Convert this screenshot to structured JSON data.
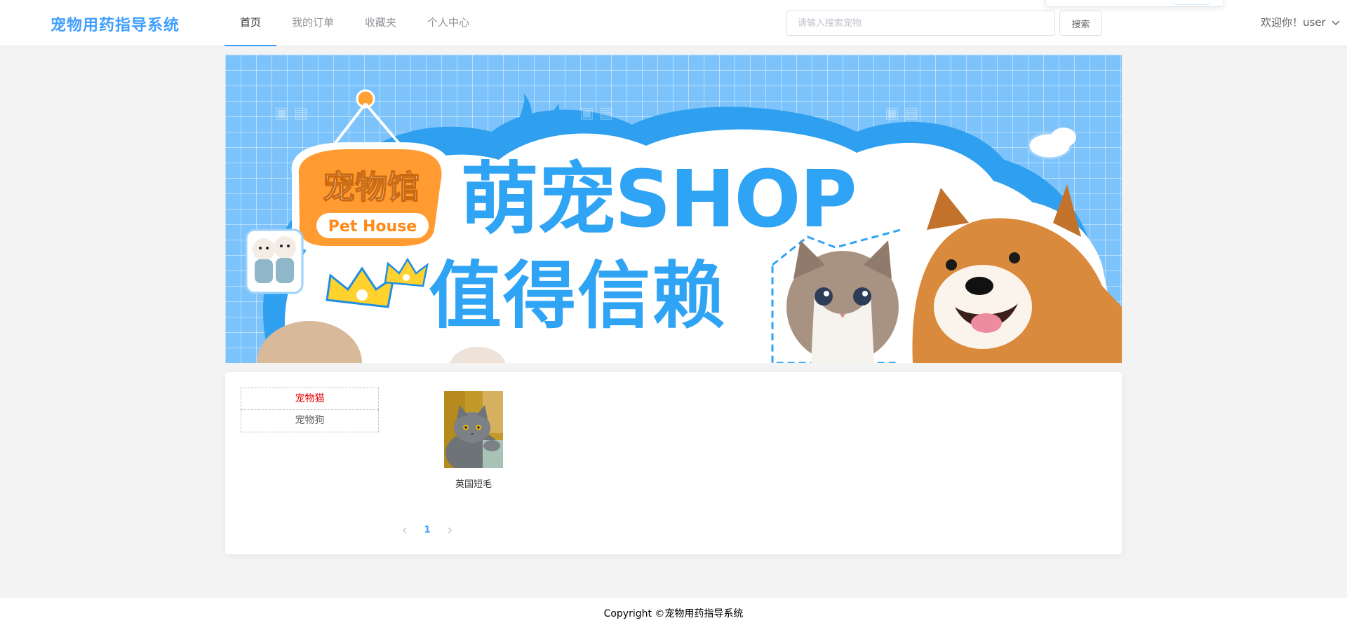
{
  "header": {
    "logo": "宠物用药指导系统",
    "nav": [
      "首页",
      "我的订单",
      "收藏夹",
      "个人中心"
    ],
    "search_placeholder": "请输入搜索宠物",
    "search_button": "搜索",
    "user_greeting": "欢迎你！user"
  },
  "banner": {
    "sign_text": "宠物馆",
    "sign_subtext": "Pet House",
    "headline_1": "萌宠SHOP",
    "headline_2": "值得信赖",
    "colors": {
      "accent_blue": "#2fa3f4",
      "sign_orange": "#ff9b30",
      "crown_yellow": "#ffd22e"
    }
  },
  "categories": [
    {
      "label": "宠物猫",
      "active": true
    },
    {
      "label": "宠物狗",
      "active": false
    }
  ],
  "pets": [
    {
      "name": "英国短毛"
    }
  ],
  "pagination": {
    "current": "1"
  },
  "footer": {
    "copyright": "Copyright ©宠物用药指导系统"
  },
  "colors": {
    "primary": "#409eff",
    "active_category": "#e60000",
    "page_bg": "#f3f3f3"
  }
}
